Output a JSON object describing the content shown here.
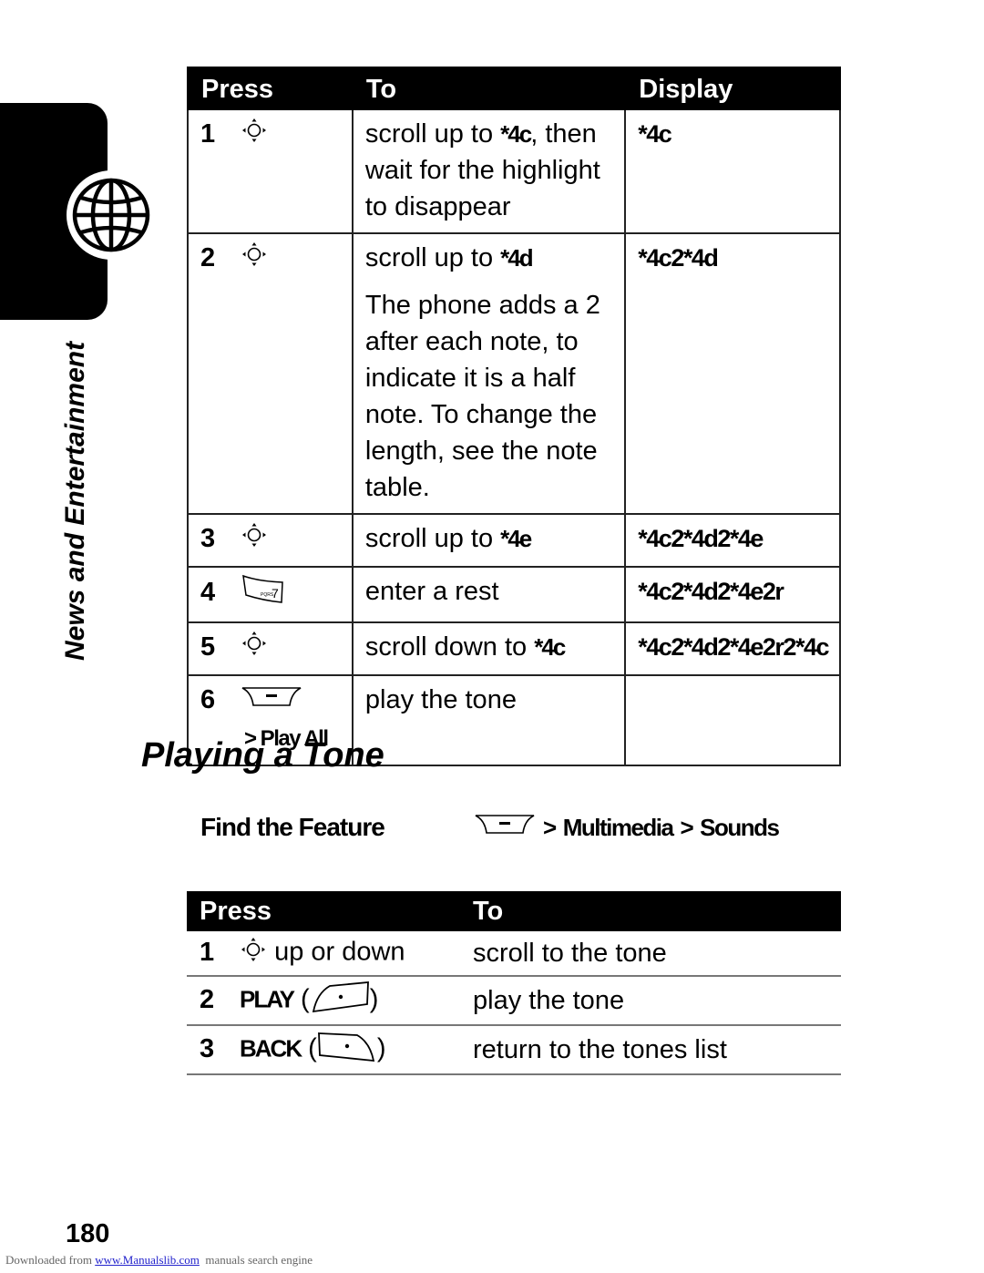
{
  "section_tab": {
    "label": "News and Entertainment",
    "icon": "globe-icon"
  },
  "compose_table": {
    "headers": {
      "press": "Press",
      "to": "To",
      "display": "Display"
    },
    "rows": [
      {
        "num": "1",
        "key_icon": "nav-key-icon",
        "to_prefix": "scroll up to ",
        "to_code": "*4c",
        "to_suffix": ", then wait for the highlight to disappear",
        "display": "*4c"
      },
      {
        "num": "2",
        "key_icon": "nav-key-icon",
        "to_prefix": "scroll up to ",
        "to_code": "*4d",
        "to_suffix": "",
        "note": "The phone adds a 2 after each note, to indicate it is a half note. To change the length, see the note table.",
        "display": "*4c2*4d"
      },
      {
        "num": "3",
        "key_icon": "nav-key-icon",
        "to_prefix": "scroll up to ",
        "to_code": "*4e",
        "to_suffix": "",
        "display": "*4c2*4d2*4e"
      },
      {
        "num": "4",
        "key_icon": "key-7-icon",
        "to_prefix": "enter a rest",
        "to_code": "",
        "to_suffix": "",
        "display": "*4c2*4d2*4e2r"
      },
      {
        "num": "5",
        "key_icon": "nav-key-icon",
        "to_prefix": "scroll down to ",
        "to_code": "*4c",
        "to_suffix": "",
        "display": "*4c2*4d2*4e2r2*4c"
      },
      {
        "num": "6",
        "key_icon": "menu-key-icon",
        "sub": "> Play All",
        "to_prefix": "play the tone",
        "to_code": "",
        "to_suffix": "",
        "display": ""
      }
    ]
  },
  "section_heading": "Playing a Tone",
  "find_feature": {
    "label": "Find the Feature",
    "icon": "menu-key-icon",
    "sep1": ">",
    "item1": "Multimedia",
    "sep2": ">",
    "item2": "Sounds"
  },
  "play_table": {
    "headers": {
      "press": "Press",
      "to": "To"
    },
    "rows": [
      {
        "num": "1",
        "press_text": "up or down",
        "to": "scroll to the tone"
      },
      {
        "num": "2",
        "press_label": "PLAY",
        "to": "play the tone"
      },
      {
        "num": "3",
        "press_label": "BACK",
        "to": "return to the tones list"
      }
    ]
  },
  "page_number": "180",
  "footer": {
    "prefix": "Downloaded from ",
    "link": "www.Manualslib.com",
    "suffix": "  manuals search engine"
  }
}
